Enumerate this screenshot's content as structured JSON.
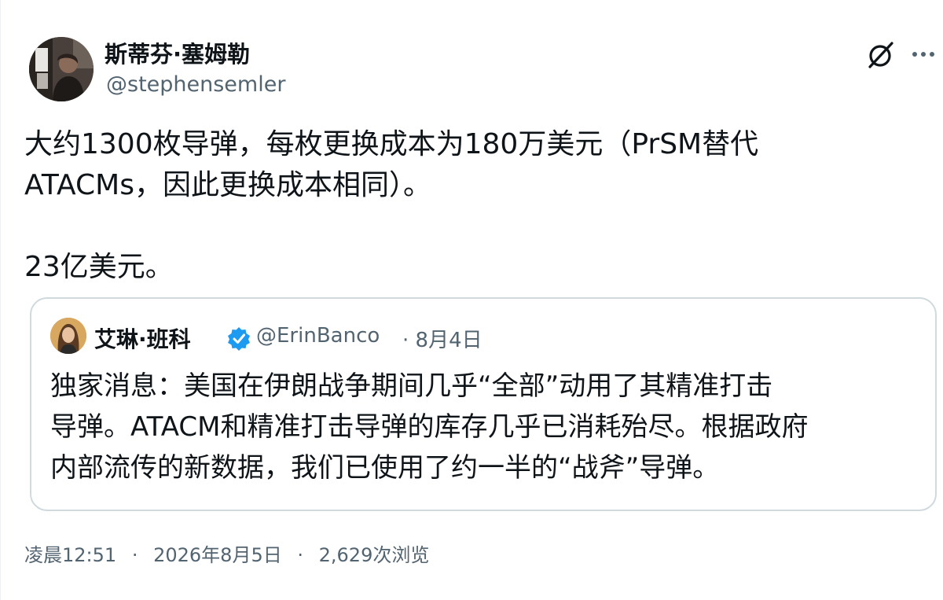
{
  "author": {
    "name": "斯蒂芬·塞姆勒",
    "handle": "@stephensemler"
  },
  "header": {
    "grok_icon": "grok-icon",
    "more_icon": "more-icon"
  },
  "tweet": {
    "line1": "大约1300枚导弹，每枚更换成本为180万美元（PrSM替代",
    "line2": "ATACMs，因此更换成本相同）。",
    "line3": "23亿美元。"
  },
  "quote": {
    "name": "艾琳·班科",
    "verified_icon": "verified-badge-icon",
    "handle": "@ErinBanco",
    "date": "· 8月4日",
    "line1": "独家消息：美国在伊朗战争期间几乎“全部”动用了其精准打击",
    "line2": "导弹。ATACM和精准打击导弹的库存几乎已消耗殆尽。根据政府",
    "line3": "内部流传的新数据，我们已使用了约一半的“战斧”导弹。"
  },
  "meta": {
    "time": "凌晨12:51",
    "sep1": "·",
    "date": "2026年8月5日",
    "sep2": "·",
    "views": "2,629次浏览"
  },
  "colors": {
    "text": "#0f1419",
    "secondary": "#536471",
    "border": "#cfd9de",
    "verified": "#1d9bf0"
  }
}
